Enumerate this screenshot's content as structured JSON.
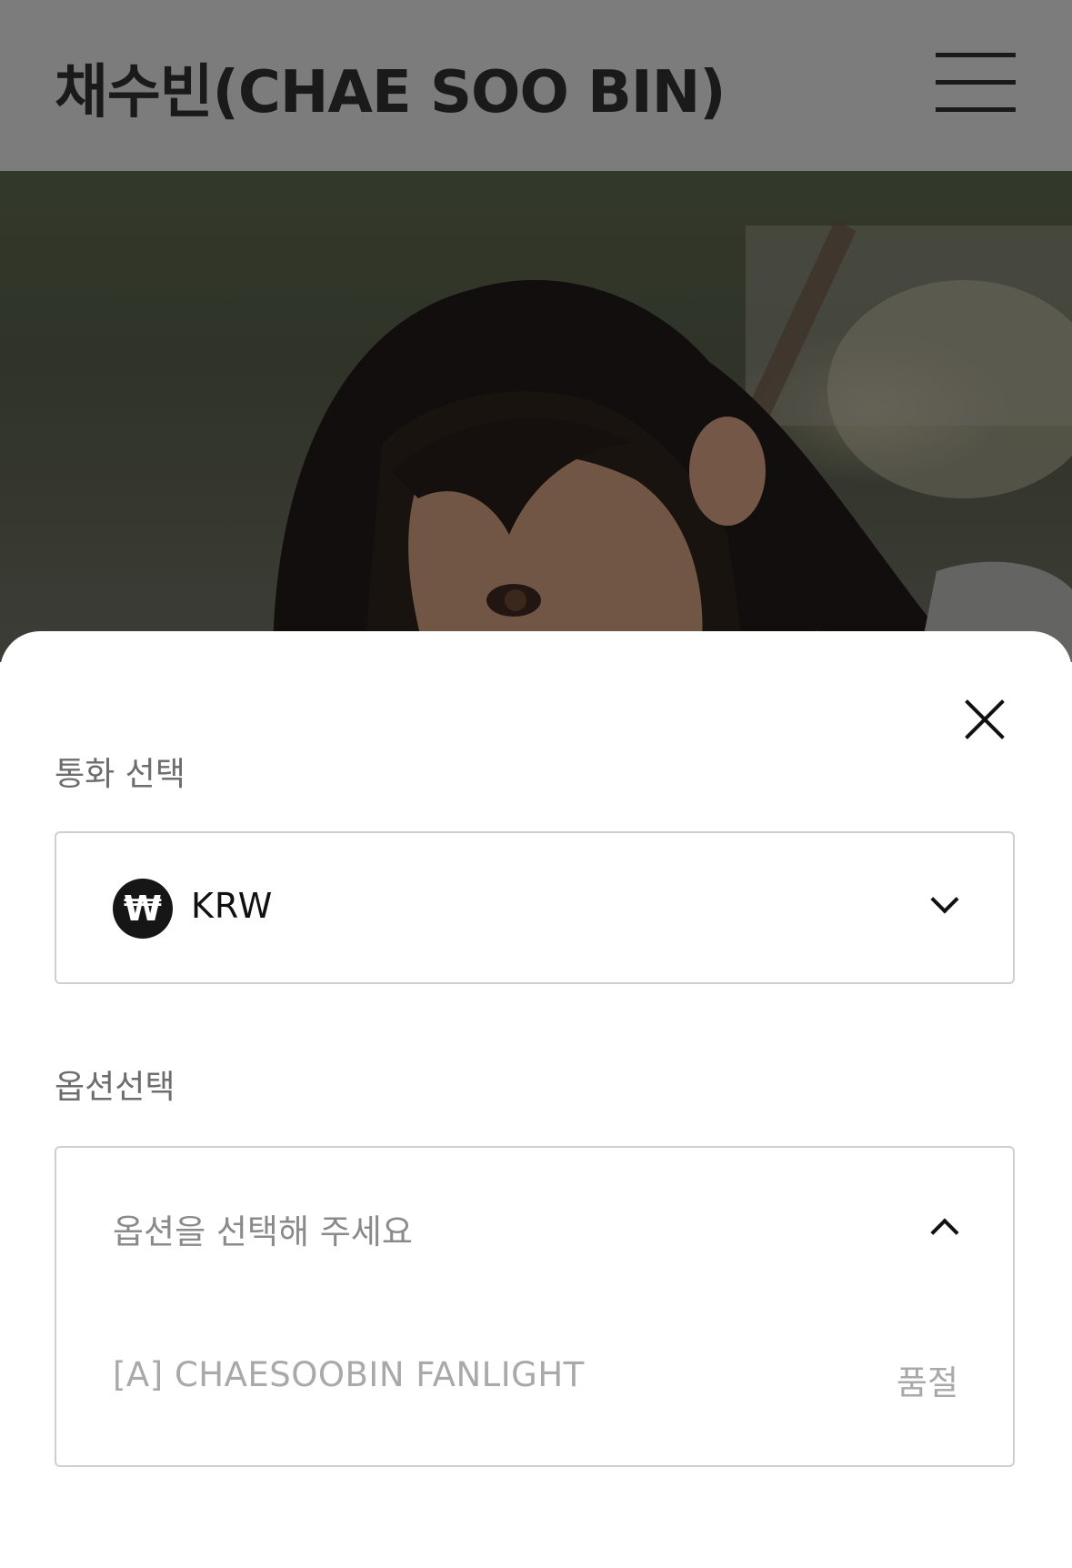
{
  "header": {
    "title": "채수빈(CHAE SOO BIN)",
    "menu_icon": "hamburger-menu-icon"
  },
  "sheet": {
    "close_icon": "close-icon",
    "currency": {
      "label": "통화 선택",
      "selected_symbol": "₩",
      "selected_value": "KRW",
      "chevron_icon": "chevron-down-icon"
    },
    "option": {
      "label": "옵션선택",
      "placeholder": "옵션을 선택해 주세요",
      "chevron_icon": "chevron-up-icon",
      "items": [
        {
          "name": "[A] CHAESOOBIN FANLIGHT",
          "status": "품절"
        }
      ]
    }
  },
  "colors": {
    "header_bg": "#7c7c7c",
    "sheet_bg": "#ffffff",
    "border": "#cfcfcf",
    "muted_text": "#a9a9a9"
  }
}
